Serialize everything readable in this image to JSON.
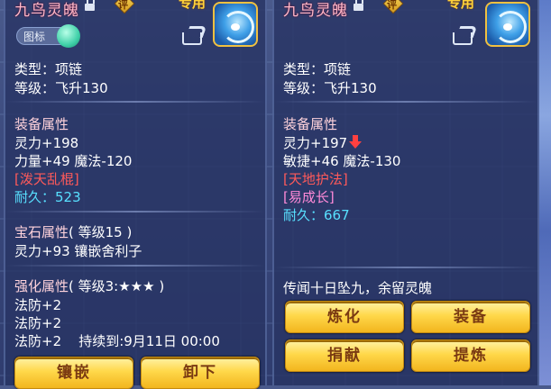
{
  "left_panel": {
    "title": "九鸟灵魄",
    "badge_ping": "评",
    "exclusive": "专用",
    "icon_toggle_label": "图标",
    "type_line": "类型：项链",
    "level_line": "等级：飞升130",
    "equip_attr_header": "装备属性",
    "attr1": "灵力+198",
    "attr2": "力量+49 魔法-120",
    "special": "[泼天乱棍]",
    "durability_label": "耐久：",
    "durability_value": "523",
    "gem_header": "宝石属性",
    "gem_level": "( 等级15 )",
    "gem_line": "灵力+93 镶嵌舍利子",
    "enhance_header": "强化属性",
    "enhance_level": "( 等级3:★★★ )",
    "enh1": "法防+2",
    "enh2": "法防+2",
    "enh3": "法防+2",
    "enh3_duration": "持续到:9月11日 00:00",
    "btn_inlay": "镶嵌",
    "btn_unequip": "卸下"
  },
  "right_panel": {
    "title": "九鸟灵魄",
    "badge_ping": "评",
    "exclusive": "专用",
    "type_line": "类型：项链",
    "level_line": "等级：飞升130",
    "equip_attr_header": "装备属性",
    "attr1": "灵力+197",
    "attr2": "敏捷+46 魔法-130",
    "special1": "[天地护法]",
    "special2": "[易成长]",
    "durability_label": "耐久：",
    "durability_value": "667",
    "lore": "传闻十日坠九，余留灵魄",
    "btn_refine": "炼化",
    "btn_equip": "装备",
    "btn_donate": "捐献",
    "btn_extract": "提炼"
  },
  "colors": {
    "header": "#ffd3dc",
    "special_red": "#ff5a5a",
    "special_pink": "#ff8ad8",
    "durability": "#58e0ff",
    "button_gold": "#ffd84a"
  },
  "icons": [
    "lock-icon",
    "rating-badge-icon",
    "pet-soul-icon",
    "share-icon",
    "toggle-knob-icon",
    "down-arrow-icon"
  ]
}
